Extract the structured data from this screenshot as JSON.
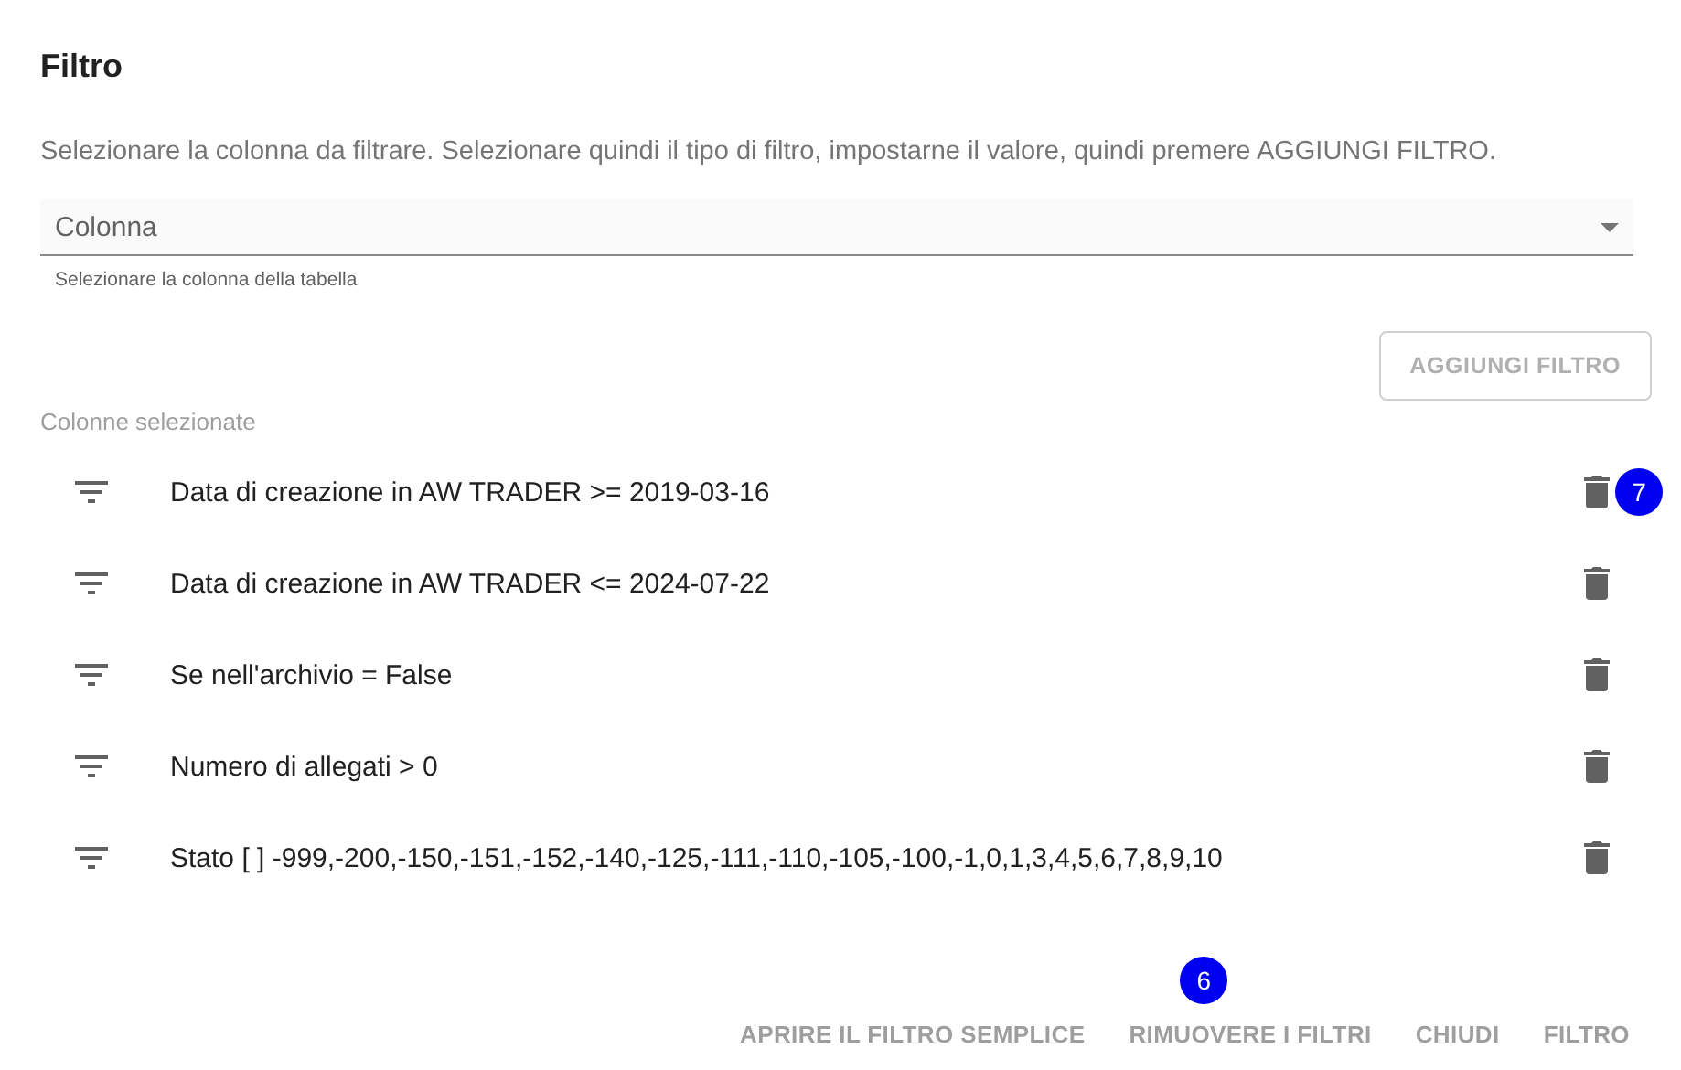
{
  "title": "Filtro",
  "description": "Selezionare la colonna da filtrare. Selezionare quindi il tipo di filtro, impostarne il valore, quindi premere AGGIUNGI FILTRO.",
  "column_select": {
    "placeholder": "Colonna",
    "hint": "Selezionare la colonna della tabella"
  },
  "add_button": {
    "label": "AGGIUNGI FILTRO",
    "disabled": true
  },
  "selected_label": "Colonne selezionate",
  "filters": [
    {
      "text": "Data di creazione in AW TRADER >= 2019-03-16",
      "badge": "7"
    },
    {
      "text": "Data di creazione in AW TRADER <= 2024-07-22"
    },
    {
      "text": "Se nell'archivio = False"
    },
    {
      "text": "Numero di allegati > 0"
    },
    {
      "text": "Stato [ ] -999,-200,-150,-151,-152,-140,-125,-111,-110,-105,-100,-1,0,1,3,4,5,6,7,8,9,10"
    }
  ],
  "footer_buttons": [
    {
      "label": "APRIRE IL FILTRO SEMPLICE"
    },
    {
      "label": "RIMUOVERE I FILTRI",
      "badge": "6"
    },
    {
      "label": "CHIUDI"
    },
    {
      "label": "FILTRO"
    }
  ]
}
